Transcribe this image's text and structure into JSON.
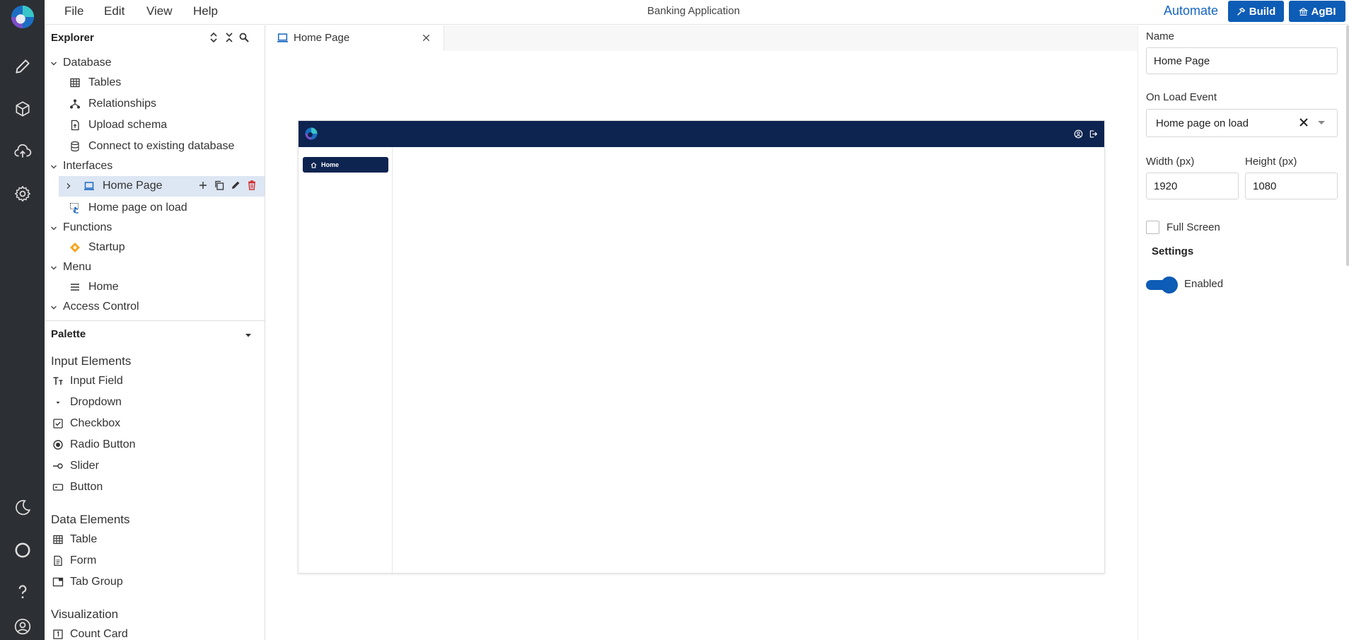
{
  "menu": {
    "file": "File",
    "edit": "Edit",
    "view": "View",
    "help": "Help"
  },
  "app_title": "Banking Application",
  "top_actions": {
    "automate": "Automate",
    "build": "Build",
    "agbi": "AgBI"
  },
  "explorer": {
    "title": "Explorer",
    "database": {
      "label": "Database",
      "items": {
        "tables": "Tables",
        "relationships": "Relationships",
        "upload_schema": "Upload schema",
        "connect": "Connect to existing database"
      }
    },
    "interfaces": {
      "label": "Interfaces",
      "home_page": "Home Page",
      "home_page_on_load": "Home page on load"
    },
    "functions": {
      "label": "Functions",
      "startup": "Startup"
    },
    "menu_section": {
      "label": "Menu",
      "home": "Home"
    },
    "access_control": {
      "label": "Access Control"
    }
  },
  "palette": {
    "title": "Palette",
    "input_elements": {
      "label": "Input Elements",
      "items": {
        "input_field": "Input Field",
        "dropdown": "Dropdown",
        "checkbox": "Checkbox",
        "radio_button": "Radio Button",
        "slider": "Slider",
        "button": "Button"
      }
    },
    "data_elements": {
      "label": "Data Elements",
      "items": {
        "table": "Table",
        "form": "Form",
        "tab_group": "Tab Group"
      }
    },
    "visualization": {
      "label": "Visualization",
      "items": {
        "count_card": "Count Card"
      }
    }
  },
  "editor": {
    "tab_label": "Home Page",
    "canvas": {
      "nav_home": "Home"
    }
  },
  "properties": {
    "name_label": "Name",
    "name_value": "Home Page",
    "on_load_label": "On Load Event",
    "on_load_value": "Home page on load",
    "width_label": "Width (px)",
    "width_value": "1920",
    "height_label": "Height (px)",
    "height_value": "1080",
    "full_screen_label": "Full Screen",
    "full_screen_checked": false,
    "settings_title": "Settings",
    "enabled_label": "Enabled",
    "enabled_on": true
  },
  "colors": {
    "rail_bg": "#2c2f33",
    "accent": "#0d5cb5",
    "canvas_header": "#0d2450",
    "selected_row": "#dde6f3",
    "delete_red": "#d32f2f",
    "function_orange": "#f5a623"
  }
}
